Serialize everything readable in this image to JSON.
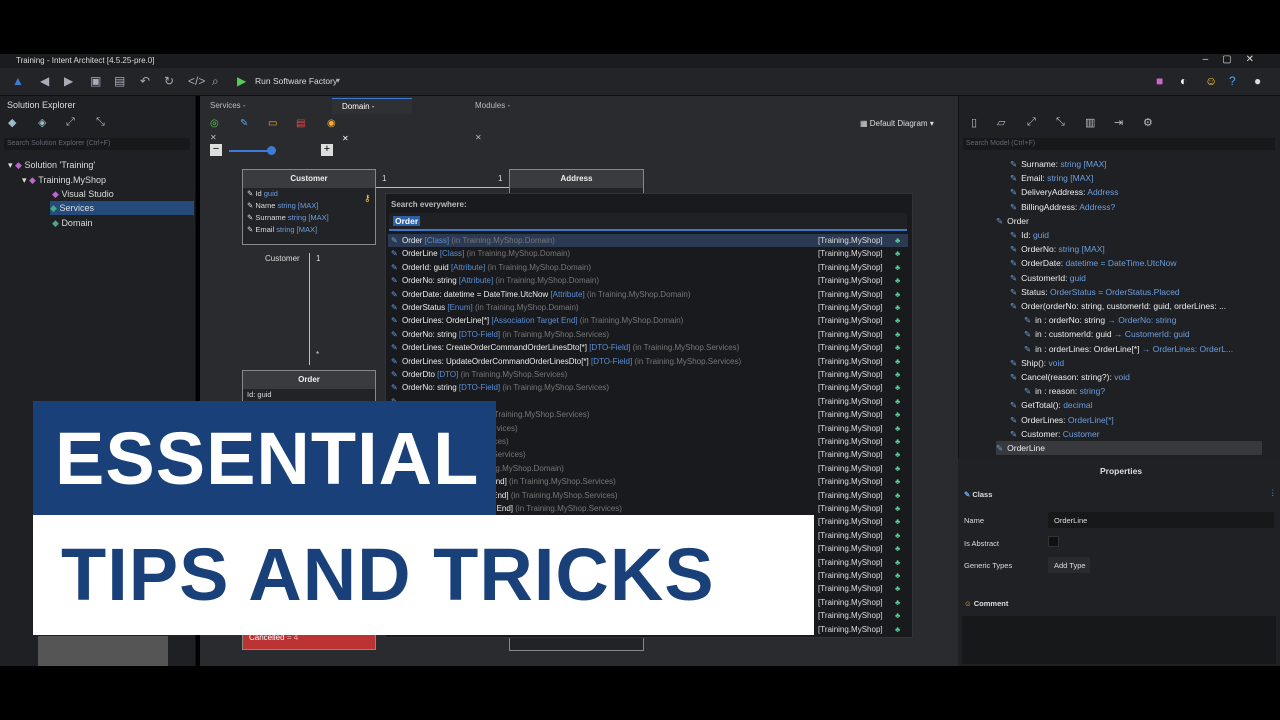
{
  "window": {
    "title": "Training - Intent Architect [4.5.25-pre.0]"
  },
  "toolbar": {
    "run_label": "Run Software Factory"
  },
  "solution_explorer": {
    "title": "Solution Explorer",
    "search_placeholder": "Search Solution Explorer (Ctrl+F)",
    "tree": [
      "Solution 'Training'",
      "Training.MyShop",
      "Visual Studio",
      "Services",
      "Domain"
    ]
  },
  "tabs": [
    "Services - Training.MyShop",
    "Domain - Training.MyShop",
    "Modules - Training.MyShop"
  ],
  "diagram": {
    "selector": "Default Diagram",
    "customer": {
      "title": "Customer",
      "attrs": [
        [
          "Id",
          "guid"
        ],
        [
          "Name",
          "string [MAX]"
        ],
        [
          "Surname",
          "string [MAX]"
        ],
        [
          "Email",
          "string [MAX]"
        ]
      ],
      "role": "Customer"
    },
    "address": {
      "title": "Address"
    },
    "order": {
      "title": "Order",
      "attr": "Id: guid"
    },
    "enum_item": "Cancelled",
    "enum_val": "= 4",
    "mult1": "1",
    "mult2": "1",
    "mult3": "1",
    "mult4": "*"
  },
  "search": {
    "label": "Search everywhere:",
    "query": "Order",
    "results": [
      [
        "Order",
        "[Class]",
        "(in Training.MyShop.Domain)"
      ],
      [
        "OrderLine",
        "[Class]",
        "(in Training.MyShop.Domain)"
      ],
      [
        "OrderId: guid",
        "[Attribute]",
        "(in Training.MyShop.Domain)"
      ],
      [
        "OrderNo: string",
        "[Attribute]",
        "(in Training.MyShop.Domain)"
      ],
      [
        "OrderDate: datetime = DateTime.UtcNow",
        "[Attribute]",
        "(in Training.MyShop.Domain)"
      ],
      [
        "OrderStatus",
        "[Enum]",
        "(in Training.MyShop.Domain)"
      ],
      [
        "OrderLines: OrderLine[*]",
        "[Association Target End]",
        "(in Training.MyShop.Domain)"
      ],
      [
        "OrderNo: string",
        "[DTO-Field]",
        "(in Training.MyShop.Services)"
      ],
      [
        "OrderLines: CreateOrderCommandOrderLinesDto[*]",
        "[DTO-Field]",
        "(in Training.MyShop.Services)"
      ],
      [
        "OrderLines: UpdateOrderCommandOrderLinesDto[*]",
        "[DTO-Field]",
        "(in Training.MyShop.Services)"
      ],
      [
        "OrderDto",
        "[DTO]",
        "(in Training.MyShop.Services)"
      ],
      [
        "OrderNo: string",
        "[DTO-Field]",
        "(in Training.MyShop.Services)"
      ],
      [
        "",
        "",
        ""
      ],
      [
        "LineDto[*]",
        "[DTO-Field]",
        "(in Training.MyShop.Services)"
      ],
      [
        "o]",
        "",
        "(in Training.MyShop.Services)"
      ],
      [
        "",
        "",
        "(in Training.MyShop.Services)"
      ],
      [
        "ield]",
        "",
        "(in Training.MyShop.Services)"
      ],
      [
        "e[*]",
        "[Parameter]",
        "(in Training.MyShop.Domain)"
      ],
      [
        "eate Entity Action Target End]",
        "",
        "(in Training.MyShop.Services)"
      ],
      [
        "elete Entity Action Target End]",
        "",
        "(in Training.MyShop.Services)"
      ],
      [
        "Query Entity Action Target End]",
        "",
        "(in Training.MyShop.Services)"
      ]
    ],
    "project": "[Training.MyShop]",
    "extra_rows": 9
  },
  "model": {
    "search_placeholder": "Search Model (Ctrl+F)",
    "items": [
      [
        "Surname:",
        "string [MAX]"
      ],
      [
        "Email:",
        "string [MAX]"
      ],
      [
        "DeliveryAddress:",
        "Address"
      ],
      [
        "BillingAddress:",
        "Address?"
      ],
      [
        "Order",
        ""
      ],
      [
        "Id:",
        "guid"
      ],
      [
        "OrderNo:",
        "string [MAX]"
      ],
      [
        "OrderDate:",
        "datetime = DateTime.UtcNow"
      ],
      [
        "CustomerId:",
        "guid"
      ],
      [
        "Status:",
        "OrderStatus = OrderStatus.Placed"
      ],
      [
        "Order(orderNo: string, customerId: guid, orderLines: ...",
        ""
      ],
      [
        "in : orderNo: string",
        "→ OrderNo: string"
      ],
      [
        "in : customerId: guid",
        "→ CustomerId: guid"
      ],
      [
        "in : orderLines: OrderLine[*]",
        "→ OrderLines: OrderL..."
      ],
      [
        "Ship():",
        "void"
      ],
      [
        "Cancel(reason: string?):",
        "void"
      ],
      [
        "in : reason:",
        "string?"
      ],
      [
        "GetTotal():",
        "decimal"
      ],
      [
        "OrderLines:",
        "OrderLine[*]"
      ],
      [
        "Customer:",
        "Customer"
      ],
      [
        "OrderLine",
        ""
      ]
    ]
  },
  "properties": {
    "title": "Properties",
    "section": "Class",
    "name_label": "Name",
    "name_value": "OrderLine",
    "abstract_label": "Is Abstract",
    "generic_label": "Generic Types",
    "add_type": "Add Type",
    "comment_label": "Comment"
  },
  "banner": {
    "line1": "ESSENTIAL",
    "line2": "TIPS AND TRICKS"
  },
  "colors": {
    "accent": "#3c7bd6",
    "banner_blue": "#1a4079"
  }
}
